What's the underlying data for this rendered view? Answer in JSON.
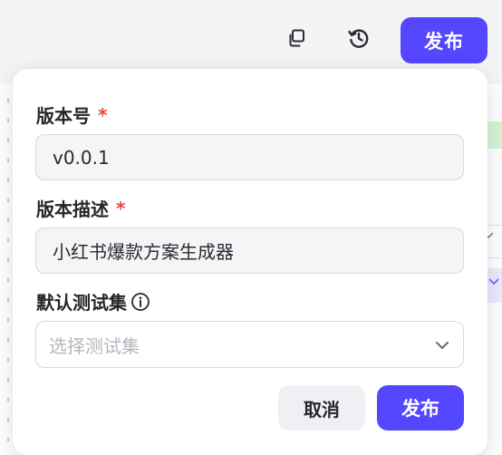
{
  "toolbar": {
    "copy_icon": "copy-icon",
    "history_icon": "history-icon",
    "publish_label": "发布"
  },
  "dialog": {
    "version": {
      "label": "版本号",
      "required_mark": "*",
      "value": "v0.0.1"
    },
    "description": {
      "label": "版本描述",
      "required_mark": "*",
      "value": "小红书爆款方案生成器"
    },
    "test_set": {
      "label": "默认测试集",
      "info_icon": "info-icon",
      "placeholder": "选择测试集"
    },
    "cancel_label": "取消",
    "publish_label": "发布"
  },
  "colors": {
    "primary": "#5546ff",
    "required": "#e5483f",
    "placeholder": "#b6b6bf"
  }
}
